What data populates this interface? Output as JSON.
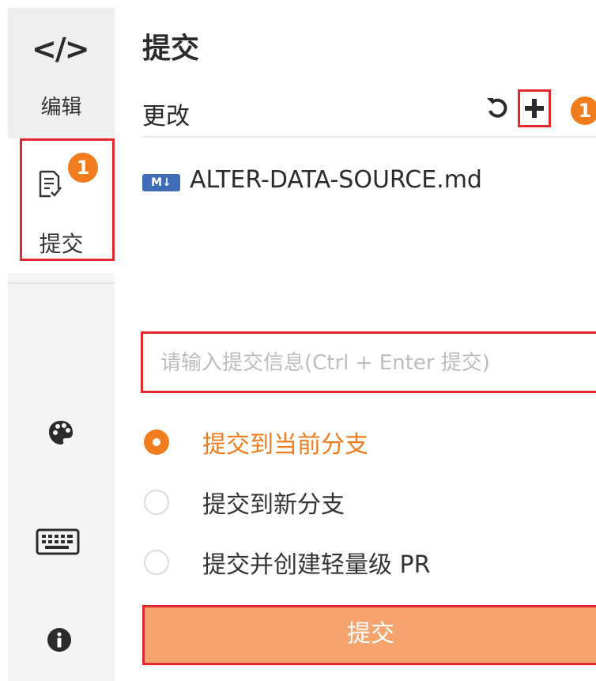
{
  "sidebar": {
    "edit": {
      "icon": "</>",
      "label": "编辑"
    },
    "commit": {
      "label": "提交",
      "badge": "1"
    },
    "icons": [
      "palette-icon",
      "keyboard-icon",
      "info-icon"
    ]
  },
  "panel": {
    "title": "提交",
    "changes_label": "更改",
    "change_count_badge": "1",
    "files": [
      {
        "type_badge": "M↓",
        "name": "ALTER-DATA-SOURCE.md"
      }
    ],
    "message_placeholder": "请输入提交信息(Ctrl + Enter 提交)",
    "options": [
      {
        "label": "提交到当前分支",
        "checked": true
      },
      {
        "label": "提交到新分支",
        "checked": false
      },
      {
        "label": "提交并创建轻量级 PR",
        "checked": false
      }
    ],
    "submit_label": "提交"
  },
  "colors": {
    "accent": "#f07c1e",
    "highlight": "#e0282e",
    "button": "#f4a46c"
  }
}
